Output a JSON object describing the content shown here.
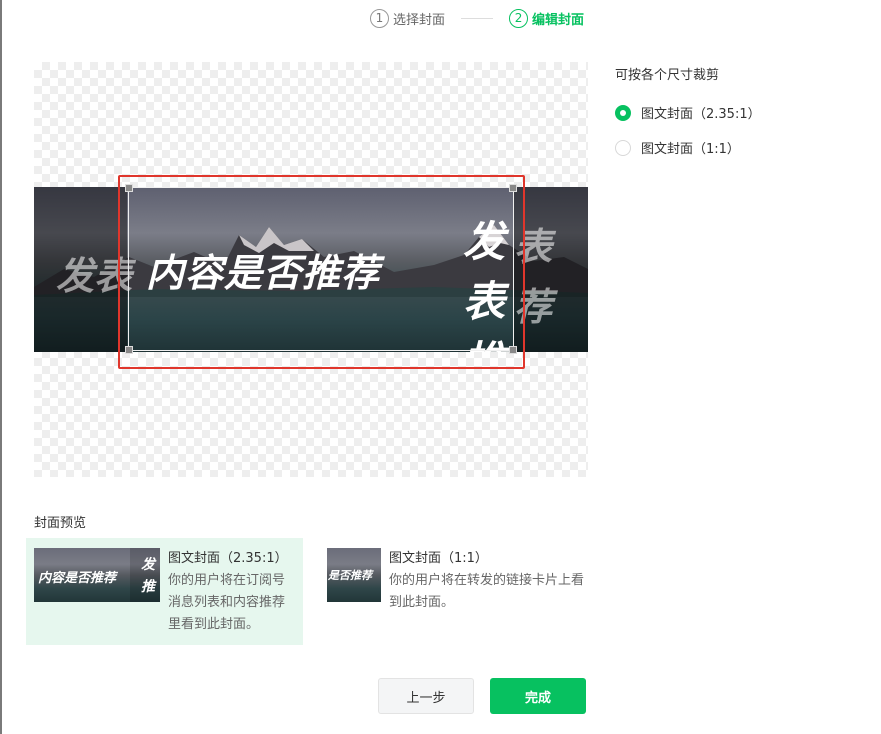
{
  "steps": [
    {
      "num": "1",
      "label": "选择封面",
      "active": false
    },
    {
      "num": "2",
      "label": "编辑封面",
      "active": true
    }
  ],
  "canvas": {
    "cover_text": "内容是否推荐",
    "side_text_line1": "发表",
    "side_text_line2": "推荐",
    "ghost_left": "发表",
    "ghost_right_1": "表",
    "ghost_right_2": "荐"
  },
  "options": {
    "title": "可按各个尺寸裁剪",
    "items": [
      {
        "label": "图文封面（2.35:1）",
        "selected": true
      },
      {
        "label": "图文封面（1:1）",
        "selected": false
      }
    ]
  },
  "preview": {
    "title": "封面预览",
    "cards": [
      {
        "name": "图文封面（2.35:1）",
        "desc": "你的用户将在订阅号消息列表和内容推荐里看到此封面。",
        "thumb_text": "内容是否推荐",
        "thumb_side": "发推"
      },
      {
        "name": "图文封面（1:1）",
        "desc": "你的用户将在转发的链接卡片上看到此封面。",
        "thumb_text": "是否推荐"
      }
    ]
  },
  "buttons": {
    "prev": "上一步",
    "done": "完成"
  },
  "colors": {
    "accent": "#07c160",
    "highlight_frame": "#e0362c",
    "selected_card_bg": "#e6f7ee"
  }
}
